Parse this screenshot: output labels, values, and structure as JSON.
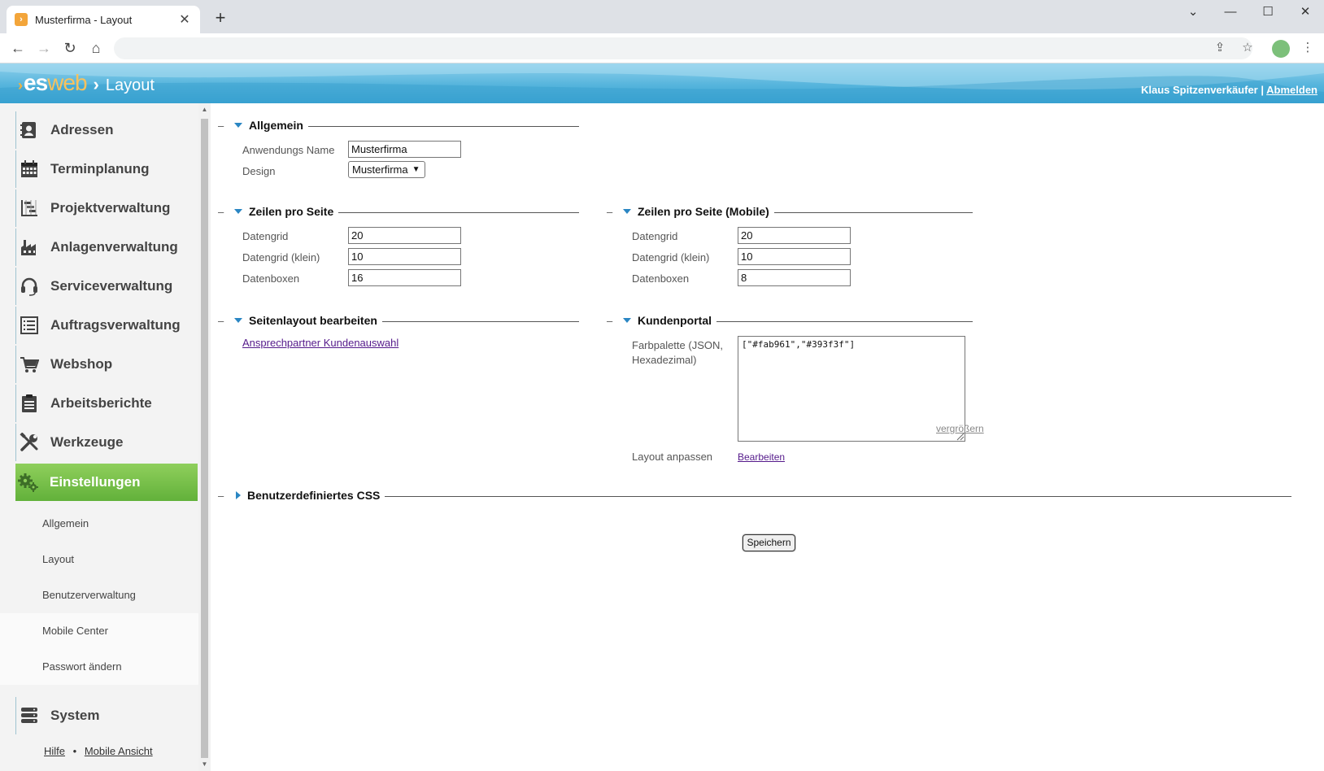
{
  "browser": {
    "tab_title": "Musterfirma - Layout",
    "tab_favicon": "esweb-favicon",
    "new_tab": "+",
    "window_controls": [
      "⌄",
      "—",
      "☐",
      "✕"
    ]
  },
  "header": {
    "logo_es": "es",
    "logo_web": "web",
    "page_title": "Layout",
    "user_name": "Klaus Spitzenverkäufer",
    "separator": "|",
    "logout": "Abmelden"
  },
  "sidebar": {
    "items": [
      {
        "label": "Adressen",
        "icon": "address-book-icon"
      },
      {
        "label": "Terminplanung",
        "icon": "calendar-icon"
      },
      {
        "label": "Projektverwaltung",
        "icon": "gantt-icon"
      },
      {
        "label": "Anlagenverwaltung",
        "icon": "factory-icon"
      },
      {
        "label": "Serviceverwaltung",
        "icon": "headset-icon"
      },
      {
        "label": "Auftragsverwaltung",
        "icon": "list-icon"
      },
      {
        "label": "Webshop",
        "icon": "cart-icon"
      },
      {
        "label": "Arbeitsberichte",
        "icon": "clipboard-icon"
      },
      {
        "label": "Werkzeuge",
        "icon": "tools-icon"
      },
      {
        "label": "Einstellungen",
        "icon": "gears-icon"
      }
    ],
    "submenu": [
      "Allgemein",
      "Layout",
      "Benutzerverwaltung",
      "Mobile Center",
      "Passwort ändern"
    ],
    "system": "System",
    "footer": {
      "help": "Hilfe",
      "bullet": "•",
      "mobile": "Mobile Ansicht"
    }
  },
  "sections": {
    "allgemein": {
      "title": "Allgemein",
      "app_name_label": "Anwendungs Name",
      "app_name_value": "Musterfirma",
      "design_label": "Design",
      "design_value": "Musterfirma"
    },
    "zeilen": {
      "title": "Zeilen pro Seite",
      "grid_label": "Datengrid",
      "grid_value": "20",
      "grid_small_label": "Datengrid (klein)",
      "grid_small_value": "10",
      "boxes_label": "Datenboxen",
      "boxes_value": "16"
    },
    "zeilen_mobile": {
      "title": "Zeilen pro Seite (Mobile)",
      "grid_label": "Datengrid",
      "grid_value": "20",
      "grid_small_label": "Datengrid (klein)",
      "grid_small_value": "10",
      "boxes_label": "Datenboxen",
      "boxes_value": "8"
    },
    "seitenlayout": {
      "title": "Seitenlayout bearbeiten",
      "link": "Ansprechpartner Kundenauswahl"
    },
    "kundenportal": {
      "title": "Kundenportal",
      "palette_label_1": "Farbpalette (JSON,",
      "palette_label_2": "Hexadezimal)",
      "palette_value": "[\"#fab961\",\"#393f3f\"]",
      "enlarge": "vergrößern",
      "layout_label": "Layout anpassen",
      "layout_link": "Bearbeiten"
    },
    "css": {
      "title": "Benutzerdefiniertes CSS"
    },
    "dash": "–"
  },
  "save_button": "Speichern",
  "colors": {
    "header_blue": "#3da6d5",
    "active_green": "#62b13a",
    "section_triangle": "#2a86c3",
    "logo_orange": "#f6b13a"
  }
}
